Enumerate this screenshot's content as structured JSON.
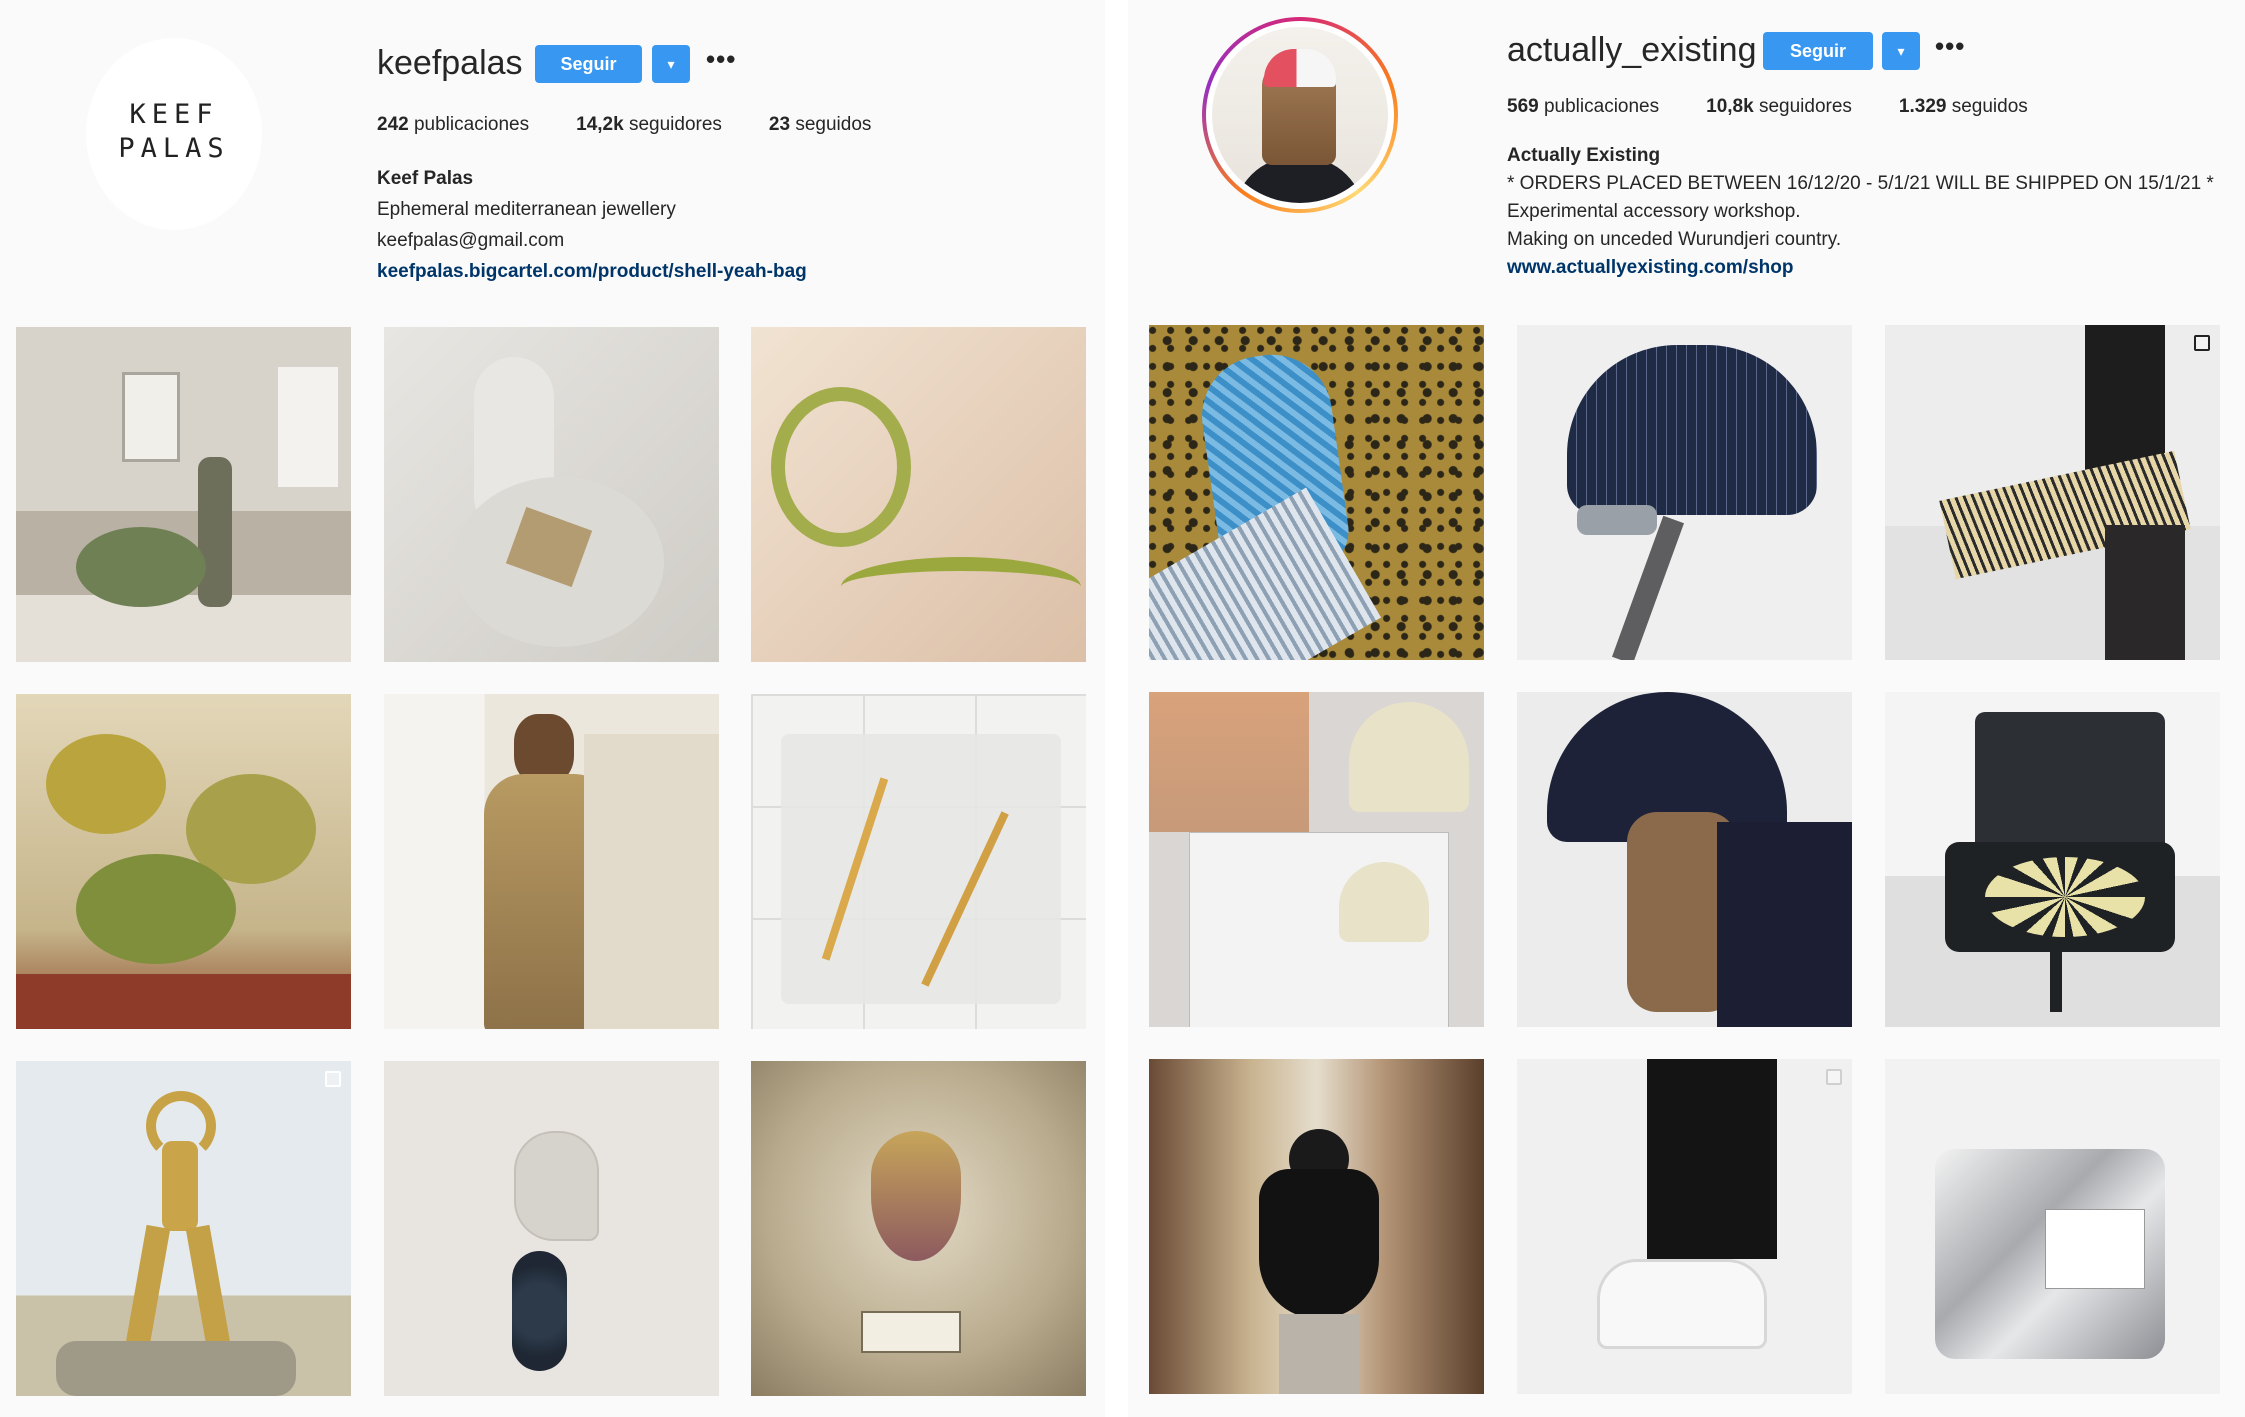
{
  "left_profile": {
    "logo_line1": "KEEF",
    "logo_line2": "PALAS",
    "username": "keefpalas",
    "follow_label": "Seguir",
    "dropdown_icon": "chevron-down-icon",
    "more_label": "•••",
    "posts_count": "242",
    "posts_label": "publicaciones",
    "followers_count": "14,2k",
    "followers_label": "seguidores",
    "following_count": "23",
    "following_label": "seguidos",
    "bio_name": "Keef Palas",
    "bio_line1": "Ephemeral mediterranean jewellery",
    "bio_line2": "keefpalas@gmail.com",
    "bio_link": "keefpalas.bigcartel.com/product/shell-yeah-bag",
    "posts": [
      "post-1",
      "post-2",
      "post-3",
      "post-4",
      "post-5",
      "post-6",
      "post-7",
      "post-8",
      "post-9"
    ]
  },
  "right_profile": {
    "username": "actually_existing",
    "follow_label": "Seguir",
    "dropdown_icon": "chevron-down-icon",
    "more_label": "•••",
    "posts_count": "569",
    "posts_label": "publicaciones",
    "followers_count": "10,8k",
    "followers_label": "seguidores",
    "following_count": "1.329",
    "following_label": "seguidos",
    "bio_name": "Actually Existing",
    "bio_line1": "* ORDERS PLACED BETWEEN 16/12/20 - 5/1/21 WILL BE SHIPPED ON 15/1/21 *",
    "bio_line2": "Experimental accessory workshop.",
    "bio_line3": "Making on unceded Wurundjeri country.",
    "bio_link": "www.actuallyexisting.com/shop",
    "posts": [
      "post-1",
      "post-2",
      "post-3",
      "post-4",
      "post-5",
      "post-6",
      "post-7",
      "post-8",
      "post-9"
    ]
  },
  "colors": {
    "button_blue": "#3897f0",
    "link_navy": "#003569",
    "background": "#fafafa"
  }
}
